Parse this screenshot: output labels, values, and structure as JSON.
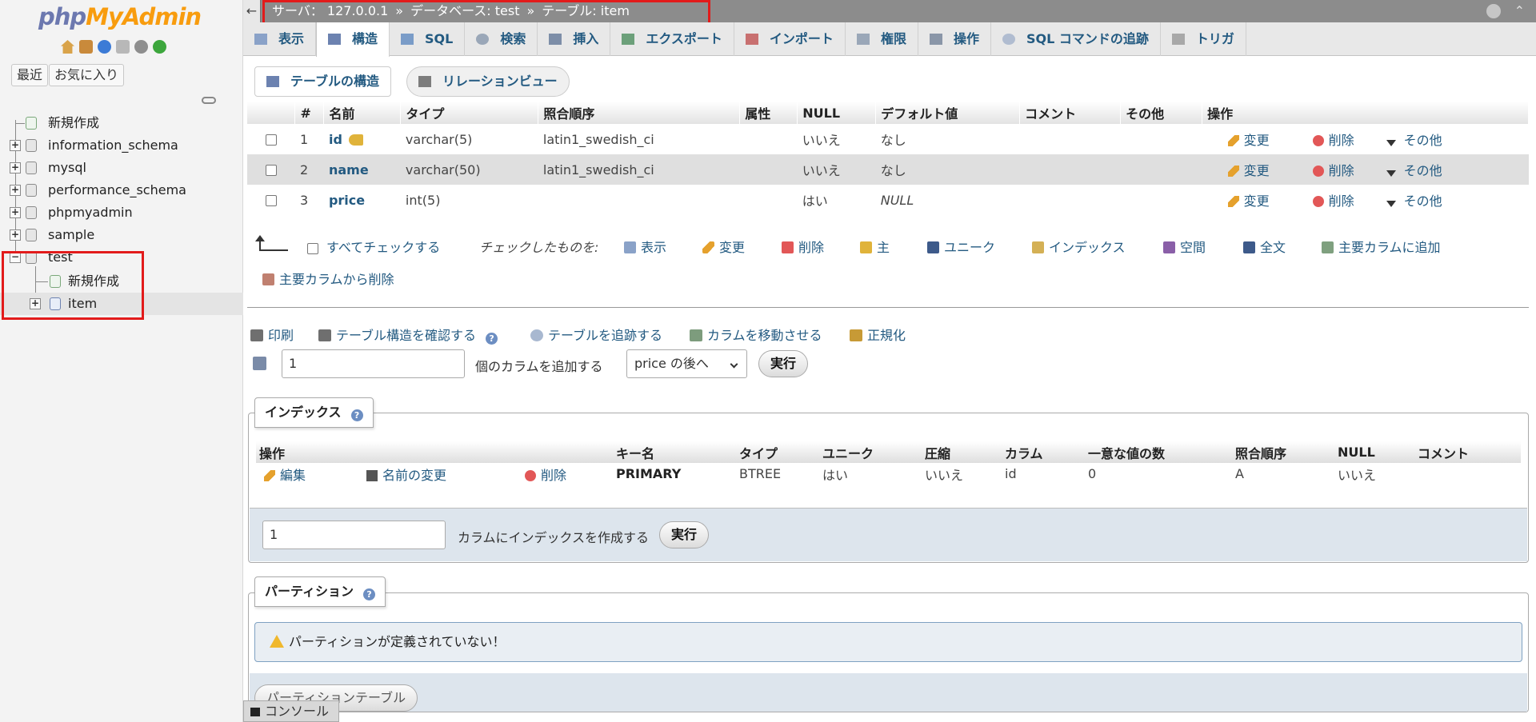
{
  "nav": {
    "logo_a": "php",
    "logo_b": "MyAdmin",
    "recent": "最近",
    "favorites": "お気に入り",
    "tree": [
      {
        "label": "新規作成"
      },
      {
        "label": "information_schema"
      },
      {
        "label": "mysql"
      },
      {
        "label": "performance_schema"
      },
      {
        "label": "phpmyadmin"
      },
      {
        "label": "sample"
      },
      {
        "label": "test"
      }
    ],
    "children": [
      {
        "label": "新規作成"
      },
      {
        "label": "item"
      }
    ]
  },
  "breadcrumb": {
    "server": "サーバ： 127.0.0.1",
    "database": "データベース: test",
    "table": "テーブル: item"
  },
  "tabs": [
    {
      "label": "表示"
    },
    {
      "label": "構造"
    },
    {
      "label": "SQL"
    },
    {
      "label": "検索"
    },
    {
      "label": "挿入"
    },
    {
      "label": "エクスポート"
    },
    {
      "label": "インポート"
    },
    {
      "label": "権限"
    },
    {
      "label": "操作"
    },
    {
      "label": "SQL コマンドの追跡"
    },
    {
      "label": "トリガ"
    }
  ],
  "subtabs": {
    "structure": "テーブルの構造",
    "relation": "リレーションビュー"
  },
  "structure": {
    "headers": [
      "#",
      "名前",
      "タイプ",
      "照合順序",
      "属性",
      "NULL",
      "デフォルト値",
      "コメント",
      "その他",
      "操作"
    ],
    "rows": [
      {
        "num": "1",
        "name": "id",
        "type": "varchar(5)",
        "collation": "latin1_swedish_ci",
        "attr": "",
        "null": "いいえ",
        "default": "なし",
        "comment": "",
        "extra": ""
      },
      {
        "num": "2",
        "name": "name",
        "type": "varchar(50)",
        "collation": "latin1_swedish_ci",
        "attr": "",
        "null": "いいえ",
        "default": "なし",
        "comment": "",
        "extra": ""
      },
      {
        "num": "3",
        "name": "price",
        "type": "int(5)",
        "collation": "",
        "attr": "",
        "null": "はい",
        "default": "NULL",
        "comment": "",
        "extra": ""
      }
    ],
    "actions": {
      "change": "変更",
      "drop": "削除",
      "more": "その他"
    }
  },
  "bulk": {
    "check_all": "すべてチェックする",
    "with_selected": "チェックしたものを:",
    "browse": "表示",
    "change": "変更",
    "drop": "削除",
    "primary": "主",
    "unique": "ユニーク",
    "index": "インデックス",
    "spatial": "空間",
    "fulltext": "全文",
    "add_central": "主要カラムに追加",
    "remove_central": "主要カラムから削除"
  },
  "tools": {
    "print": "印刷",
    "propose": "テーブル構造を確認する",
    "track": "テーブルを追跡する",
    "move": "カラムを移動させる",
    "normalize": "正規化"
  },
  "add_columns": {
    "count": "1",
    "label": "個のカラムを追加する",
    "position": "price の後へ",
    "go": "実行"
  },
  "indexes": {
    "title": "インデックス",
    "headers": [
      "操作",
      "",
      "",
      "キー名",
      "タイプ",
      "ユニーク",
      "圧縮",
      "カラム",
      "一意な値の数",
      "照合順序",
      "NULL",
      "コメント"
    ],
    "edit": "編集",
    "rename": "名前の変更",
    "drop": "削除",
    "row": {
      "key": "PRIMARY",
      "type": "BTREE",
      "unique": "はい",
      "packed": "いいえ",
      "column": "id",
      "cardinality": "0",
      "collation": "A",
      "null": "いいえ",
      "comment": ""
    },
    "create_count": "1",
    "create_label": "カラムにインデックスを作成する",
    "go": "実行"
  },
  "partitions": {
    "title": "パーティション",
    "warning": "パーティションが定義されていない！",
    "button": "パーティションテーブル"
  },
  "console": "コンソール"
}
